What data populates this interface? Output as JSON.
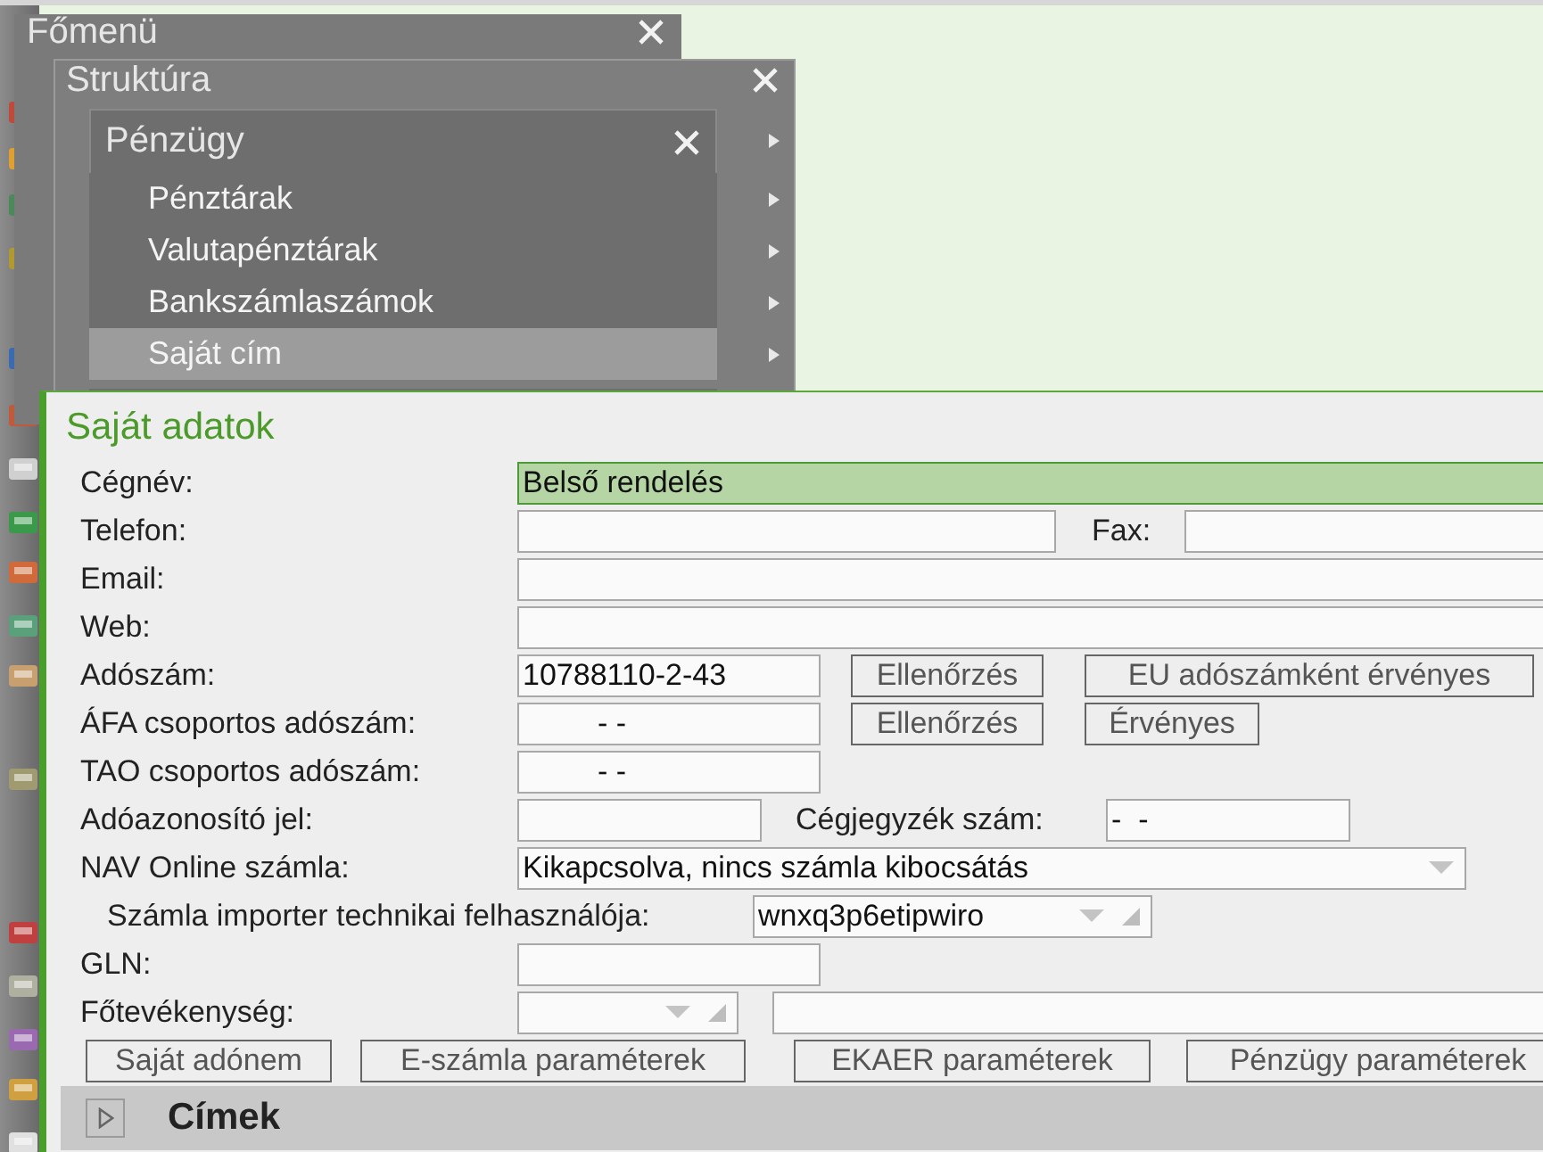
{
  "menus": [
    {
      "title": "Főmenü"
    },
    {
      "title": "Struktúra"
    },
    {
      "title": "Pénzügy",
      "items": [
        {
          "label": "Pénztárak",
          "selected": false,
          "submenu": true
        },
        {
          "label": "Valutapénztárak",
          "selected": false,
          "submenu": true
        },
        {
          "label": "Bankszámlaszámok",
          "selected": false,
          "submenu": true
        },
        {
          "label": "Saját cím",
          "selected": true,
          "submenu": true
        }
      ]
    }
  ],
  "form": {
    "title": "Saját adatok",
    "rows": [
      {
        "items": [
          {
            "kind": "label",
            "text": "Cégnév:"
          },
          {
            "kind": "input",
            "value": "Belső rendelés",
            "focused": true
          }
        ]
      },
      {
        "items": [
          {
            "kind": "label",
            "text": "Telefon:"
          },
          {
            "kind": "input",
            "focused": false
          },
          {
            "kind": "label",
            "text": "Fax:"
          },
          {
            "kind": "input",
            "focused": false
          }
        ]
      },
      {
        "items": [
          {
            "kind": "label",
            "text": "Email:"
          },
          {
            "kind": "input",
            "focused": false
          }
        ]
      },
      {
        "items": [
          {
            "kind": "label",
            "text": "Web:"
          },
          {
            "kind": "input",
            "focused": false
          }
        ]
      },
      {
        "items": [
          {
            "kind": "label",
            "text": "Adószám:"
          },
          {
            "kind": "input",
            "value": "10788110-2-43",
            "focused": false
          },
          {
            "kind": "button",
            "text": "Ellenőrzés"
          },
          {
            "kind": "button",
            "text": "EU adószámként érvényes"
          }
        ]
      },
      {
        "items": [
          {
            "kind": "label",
            "text": "ÁFA csoportos adószám:"
          },
          {
            "kind": "masked",
            "value": "- -",
            "focused": false
          },
          {
            "kind": "button",
            "text": "Ellenőrzés"
          },
          {
            "kind": "button",
            "text": "Érvényes"
          }
        ]
      },
      {
        "items": [
          {
            "kind": "label",
            "text": "TAO csoportos adószám:"
          },
          {
            "kind": "masked",
            "value": "- -",
            "focused": false
          }
        ]
      },
      {
        "items": [
          {
            "kind": "label",
            "text": "Adóazonosító jel:"
          },
          {
            "kind": "input",
            "focused": false
          },
          {
            "kind": "label",
            "text": "Cégjegyzék szám:"
          },
          {
            "kind": "input",
            "value": "-  -",
            "focused": false
          }
        ]
      },
      {
        "items": [
          {
            "kind": "label",
            "text": "NAV Online számla:"
          },
          {
            "kind": "select",
            "value": "Kikapcsolva, nincs számla kibocsátás",
            "grip": false
          }
        ]
      },
      {
        "items": [
          {
            "kind": "label",
            "text": "Számla importer technikai felhasználója:"
          },
          {
            "kind": "select",
            "value": "wnxq3p6etipwiro",
            "grip": true
          }
        ]
      },
      {
        "items": [
          {
            "kind": "label",
            "text": "GLN:"
          },
          {
            "kind": "input",
            "focused": false
          }
        ]
      },
      {
        "items": [
          {
            "kind": "label",
            "text": "Főtevékenység:"
          },
          {
            "kind": "select",
            "grip": true
          },
          {
            "kind": "input",
            "focused": false
          }
        ]
      },
      {
        "items": [
          {
            "kind": "button",
            "text": "Saját adónem"
          },
          {
            "kind": "button",
            "text": "E-számla paraméterek"
          },
          {
            "kind": "button",
            "text": "EKAER paraméterek"
          },
          {
            "kind": "button",
            "text": "Pénzügy paraméterek"
          }
        ]
      }
    ],
    "section": {
      "title": "Címek",
      "expanded": false
    }
  }
}
